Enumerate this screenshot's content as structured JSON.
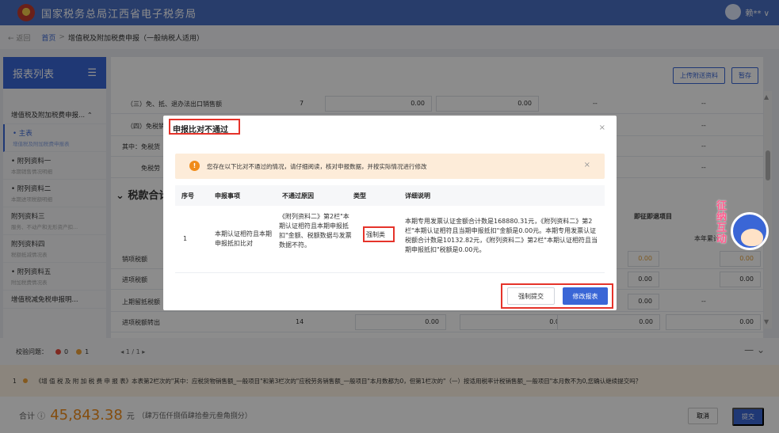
{
  "app": {
    "title": "国家税务总局江西省电子税务局",
    "user": "赖** ∨"
  },
  "breadcrumb": {
    "back": "← 返回",
    "home": "首页",
    "sep": ">",
    "current": "增值税及附加税费申报（一般纳税人适用）"
  },
  "sidebar": {
    "header": "报表列表",
    "menu_icon": "☰",
    "items": [
      {
        "title": "增值税及附加税费申报... ⌃",
        "sub": ""
      },
      {
        "title": "• 主表",
        "sub": "增值税及附加税费申报表"
      },
      {
        "title": "• 附列资料一",
        "sub": "本期销售情况明细"
      },
      {
        "title": "• 附列资料二",
        "sub": "本期进项税额明细"
      },
      {
        "title": "附列资料三",
        "sub": "服务、不动产和无形资产扣..."
      },
      {
        "title": "附列资料四",
        "sub": "税额抵减情况表"
      },
      {
        "title": "• 附列资料五",
        "sub": "附加税费情况表"
      },
      {
        "title": "增值税减免税申报明...",
        "sub": ""
      }
    ]
  },
  "toolbar": {
    "upload": "上传附送资料",
    "save": "暂存"
  },
  "background_rows": {
    "r1": {
      "label": "（三）免、抵、退办法出口销售额",
      "num": "7",
      "v1": "0.00",
      "v2": "0.00",
      "v3": "--",
      "v4": "--"
    },
    "r2": {
      "label": "（四）免税销",
      "v3": "--"
    },
    "r3": {
      "label": "其中：免税货",
      "v3": "--"
    },
    "r4": {
      "label": "免税劳",
      "v3": "--"
    },
    "r5": {
      "label": "销项税额",
      "v1": "0.00",
      "v2": "0.00"
    },
    "r6": {
      "label": "进项税额",
      "v1": "0.00",
      "v2": "0.00"
    },
    "r7": {
      "label": "上期留抵税额",
      "v1": "0.00",
      "v2": "--"
    },
    "r8": {
      "label": "进项税额转出",
      "num": "14",
      "v1": "0.00",
      "v2": "0.00",
      "v3": "0.00",
      "v4": "0.00"
    }
  },
  "section": {
    "title": "税款合计"
  },
  "column_headers": {
    "immediate": "即征即退项目",
    "year_total": "本年累计"
  },
  "check_bar": {
    "label": "校验问题：",
    "red_count": "0",
    "orange_count": "1",
    "pager": "◂  1 / 1  ▸",
    "collapse": "— ⌄"
  },
  "message": {
    "index": "1",
    "text": "《增 值 税 及 附 加 税 费 申 报 表》本表第2栏次的\"其中：应税货物销售额_一般项目\"和第3栏次的\"应税劳务销售额_一般项目\"本月数都为0，但第1栏次的\"（一）按适用税率计税销售额_一般项目\"本月数不为0,您确认继续提交吗？"
  },
  "footer": {
    "total_label": "合计 ⓘ",
    "total_amount": "45,843.38",
    "unit": "元",
    "total_words": "（肆万伍仟捌佰肆拾叁元叁角捌分）",
    "cancel": "取消",
    "submit": "提交"
  },
  "mascot": {
    "text_line1": "纳",
    "text_line2": "互",
    "text_line3": "动",
    "badge": "征"
  },
  "modal": {
    "title": "申报比对不通过",
    "close": "×",
    "alert_text": "您存在以下比对不通过的情况，请仔细阅读，核对申报数据，并按实际情况进行修改",
    "alert_icon": "!",
    "alert_close": "×",
    "columns": [
      "序号",
      "申报事项",
      "不通过原因",
      "类型",
      "详细说明"
    ],
    "rows": [
      {
        "index": "1",
        "item": "本期认证相符且本期申报抵扣比对",
        "reason": "《附列资料二》第2栏\"本期认证相符且本期申报抵扣\"金额、税额数据与发票数据不符。",
        "type": "强制类",
        "detail": "本期专用发票认证金额合计数是168880.31元，《附列资料二》第2栏\"本期认证相符且当期申报抵扣\"金额是0.00元。本期专用发票认证税额合计数是10132.82元，《附列资料二》第2栏\"本期认证相符且当期申报抵扣\"税额是0.00元。"
      }
    ],
    "force_submit": "强制提交",
    "modify": "修改报表"
  }
}
